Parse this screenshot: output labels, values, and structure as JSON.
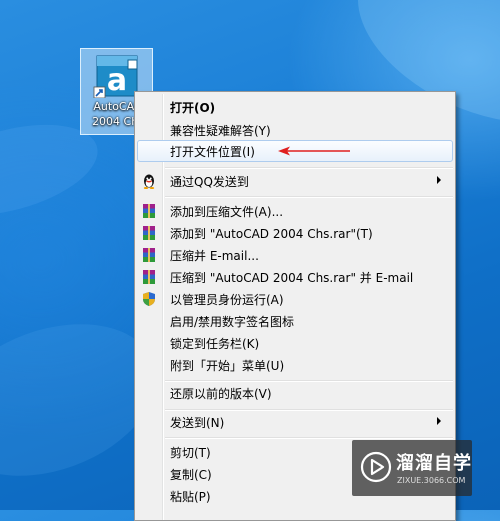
{
  "desktop": {
    "icon": {
      "name": "autocad-shortcut-icon",
      "label_line1": "AutoCAD",
      "label_line2": "2004 Chs"
    }
  },
  "context_menu": {
    "items": [
      {
        "label": "打开(O)",
        "bold": true
      },
      {
        "label": "兼容性疑难解答(Y)"
      },
      {
        "label": "打开文件位置(I)",
        "highlighted": true
      },
      {
        "label": "通过QQ发送到",
        "icon": "qq-penguin-icon",
        "submenu": true
      },
      {
        "label": "添加到压缩文件(A)...",
        "icon": "winrar-icon"
      },
      {
        "label": "添加到 \"AutoCAD 2004 Chs.rar\"(T)",
        "icon": "winrar-icon"
      },
      {
        "label": "压缩并 E-mail...",
        "icon": "winrar-icon"
      },
      {
        "label": "压缩到 \"AutoCAD 2004 Chs.rar\" 并 E-mail",
        "icon": "winrar-icon"
      },
      {
        "label": "以管理员身份运行(A)",
        "icon": "uac-shield-icon"
      },
      {
        "label": "启用/禁用数字签名图标"
      },
      {
        "label": "锁定到任务栏(K)"
      },
      {
        "label": "附到「开始」菜单(U)"
      },
      {
        "label": "还原以前的版本(V)"
      },
      {
        "label": "发送到(N)",
        "submenu": true
      },
      {
        "label": "剪切(T)"
      },
      {
        "label": "复制(C)"
      },
      {
        "label": "粘贴(P)"
      }
    ]
  },
  "annotation": {
    "color": "#e02020"
  },
  "watermark": {
    "title": "溜溜自学",
    "subtitle": "ZIXUE.3066.COM"
  },
  "colors": {
    "menu_bg": "#f0f0f0",
    "highlight_border": "#aeccee",
    "desktop_blue": "#1b7fd6"
  }
}
